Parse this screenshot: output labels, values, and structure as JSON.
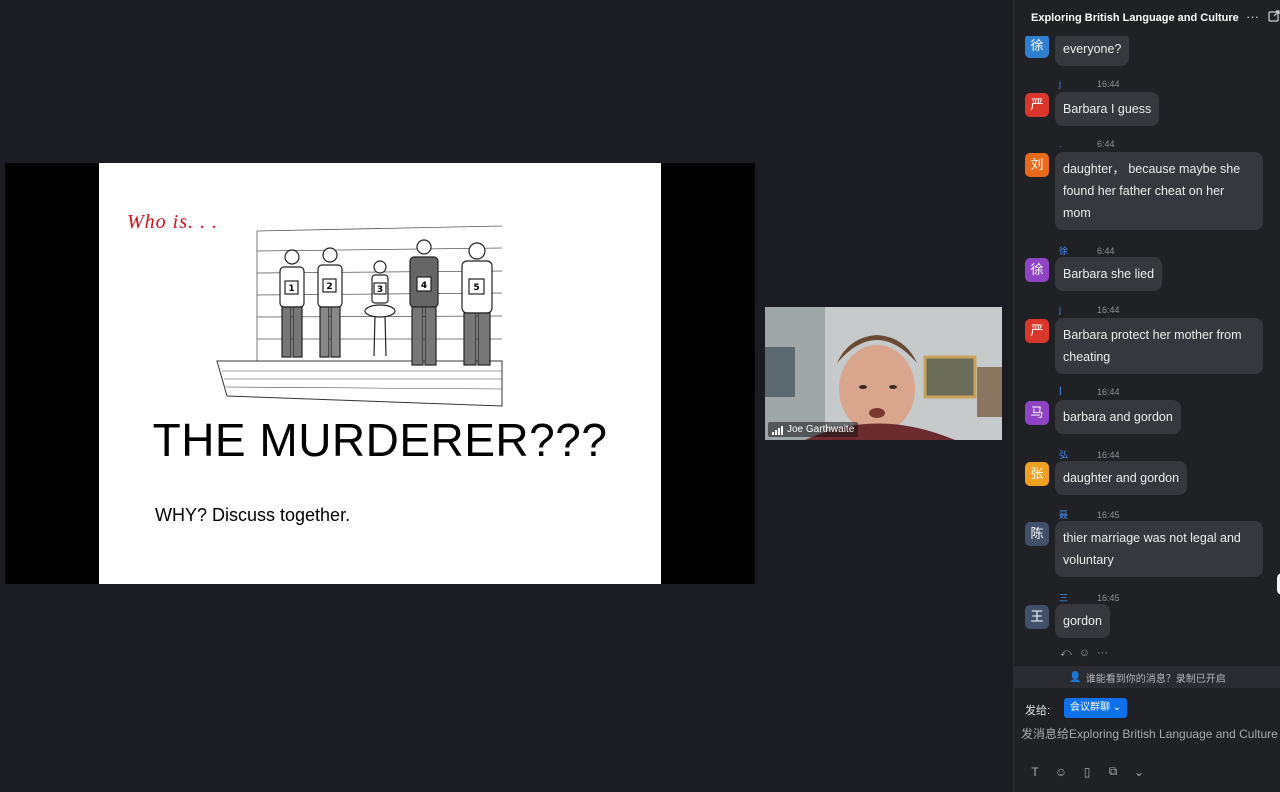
{
  "slide": {
    "who_is": "Who is. . .",
    "title": "THE MURDERER???",
    "subtitle": "WHY? Discuss together."
  },
  "video": {
    "participant_name": "Joe Garthwaite"
  },
  "chat": {
    "title": "Exploring British Language and Culture",
    "messages": [
      {
        "avatar": "徐",
        "avatar_color": "#2f7fd3",
        "name": "",
        "time": "",
        "text": "everyone?"
      },
      {
        "avatar": "严",
        "avatar_color": "#d9372c",
        "name": "j",
        "time": "16:44",
        "text": "Barbara I guess"
      },
      {
        "avatar": "刘",
        "avatar_color": "#e86a1a",
        "name": ".",
        "time": "6:44",
        "text": "daughter， because maybe she found her father cheat on her mom"
      },
      {
        "avatar": "徐",
        "avatar_color": "#8e44c4",
        "name": "徐",
        "time": "6:44",
        "text": "Barbara she lied"
      },
      {
        "avatar": "严",
        "avatar_color": "#d9372c",
        "name": "j",
        "time": "16:44",
        "text": "Barbara protect her mother from cheating"
      },
      {
        "avatar": "马",
        "avatar_color": "#8e44c4",
        "name": "ꟾ",
        "time": "16:44",
        "text": "barbara and gordon"
      },
      {
        "avatar": "张",
        "avatar_color": "#f0a020",
        "name": "弘",
        "time": "16:44",
        "text": "daughter and gordon"
      },
      {
        "avatar": "陈",
        "avatar_color": "#3f5068",
        "name": "聂",
        "time": "16:45",
        "text": "thier marriage was not legal and voluntary"
      },
      {
        "avatar": "王",
        "avatar_color": "#3f5068",
        "name": "三",
        "time": "16:45",
        "text": "gordon"
      }
    ],
    "notice": "谁能看到你的消息？录制已开启",
    "send_to_label": "发给:",
    "send_to_value": "会议群聊",
    "input_placeholder": "发消息给Exploring British Language and Culture"
  }
}
